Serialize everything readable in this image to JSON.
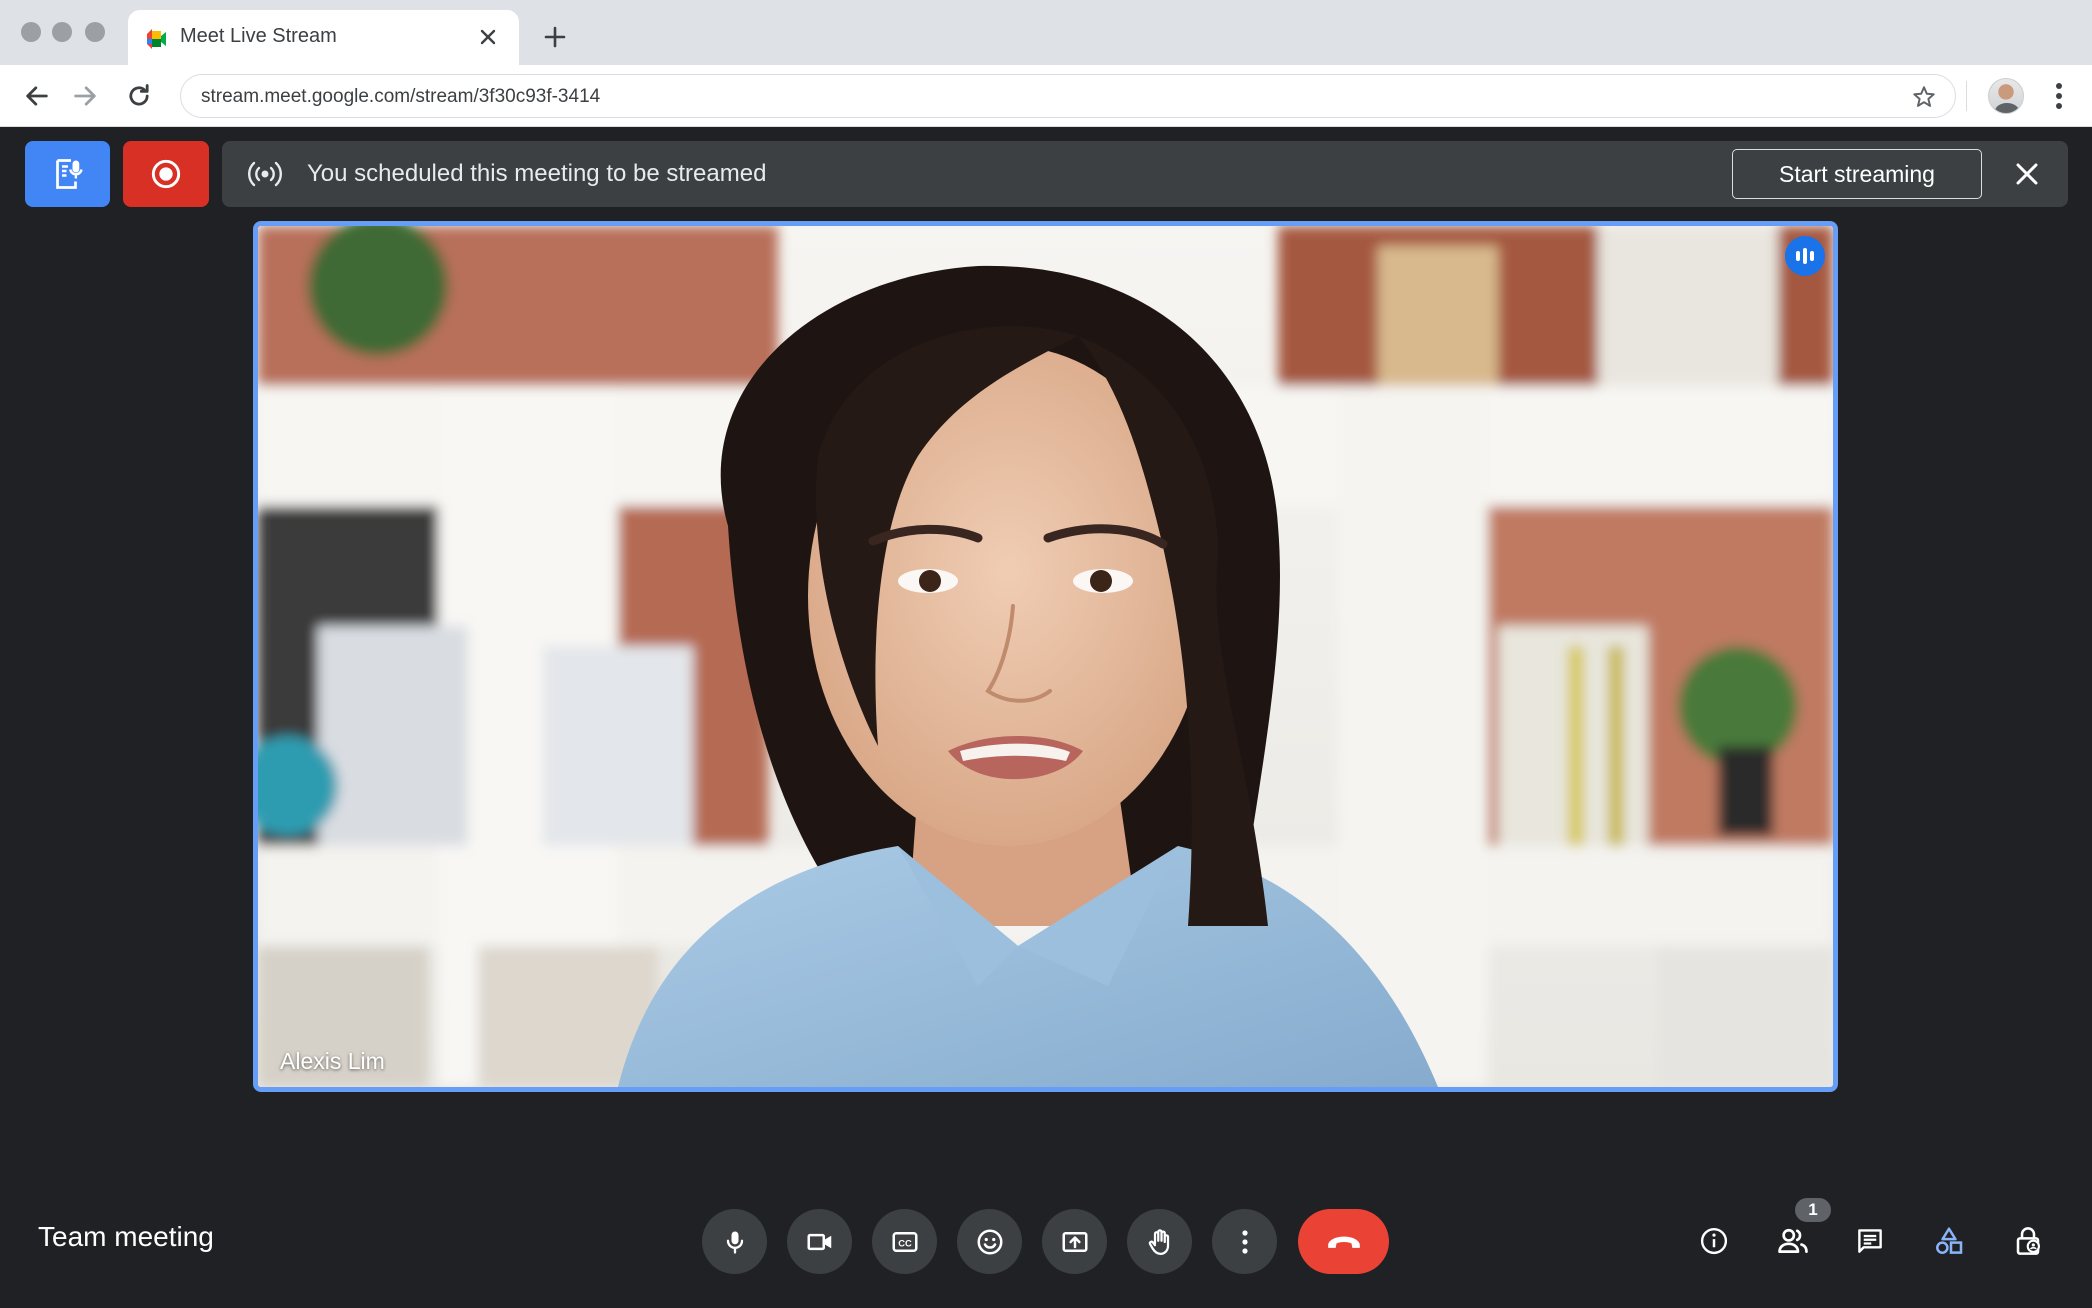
{
  "browser": {
    "tab_title": "Meet Live Stream",
    "url": "stream.meet.google.com/stream/3f30c93f-3414",
    "icons": {
      "window_controls": [
        "window-close-icon",
        "window-minimize-icon",
        "window-maximize-icon"
      ],
      "tab_close": "close-icon",
      "new_tab": "plus-icon",
      "back": "arrow-back-icon",
      "forward": "arrow-forward-icon",
      "reload": "reload-icon",
      "bookmark": "star-icon",
      "menu": "more-vert-icon"
    }
  },
  "banner": {
    "message": "You scheduled this meeting to be streamed",
    "start_label": "Start streaming",
    "icons": {
      "transcript": "transcript-mic-icon",
      "recording": "record-icon",
      "broadcast": "broadcast-icon",
      "dismiss": "close-icon"
    }
  },
  "video": {
    "participant_name": "Alexis Lim",
    "speaking_indicator": "audio-level-icon"
  },
  "bottom_bar": {
    "meeting_name": "Team meeting",
    "controls": [
      "mic-icon",
      "camera-icon",
      "closed-captions-icon",
      "emoji-icon",
      "present-screen-icon",
      "raise-hand-icon",
      "more-options-icon",
      "hang-up-icon"
    ],
    "right_icons": [
      "info-icon",
      "people-icon",
      "chat-icon",
      "activities-icon",
      "host-controls-icon"
    ],
    "people_count": "1"
  },
  "colors": {
    "background": "#202124",
    "accent_blue": "#4285f4",
    "record_red": "#d93025",
    "hangup_red": "#ea4335",
    "tile_border": "#669df6"
  }
}
